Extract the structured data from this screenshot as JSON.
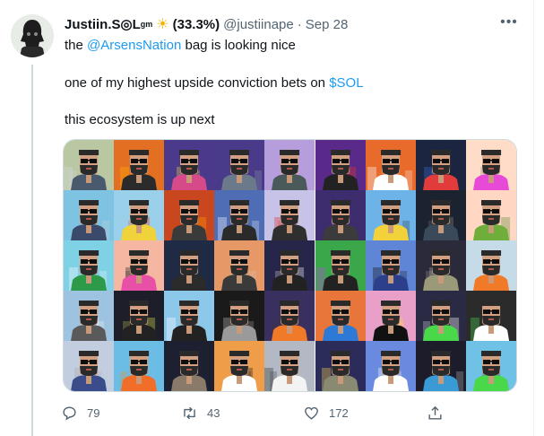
{
  "tweet": {
    "display_name": "Justiin.S◎L",
    "name_superscript": "gm",
    "sun_emoji": "☀",
    "percent": "(33.3%)",
    "handle": "@justiinape",
    "separator": "·",
    "date": "Sep 28",
    "more_label": "•••",
    "line1_prefix": "the ",
    "mention": "@ArsensNation",
    "line1_suffix": " bag is looking nice",
    "line2_prefix": "one of my highest upside conviction bets on ",
    "cashtag": "$SOL",
    "line3": "this ecosystem is up next",
    "actions": {
      "reply_count": "79",
      "retweet_count": "43",
      "like_count": "172"
    }
  },
  "colors": {
    "link": "#1d9bf0",
    "secondary_text": "#536471",
    "primary_text": "#0f1419",
    "sun": "#f5b400"
  },
  "nft_grid": {
    "columns": 9,
    "rows": 5,
    "cells": [
      {
        "bg": "#b9c7a3",
        "shirt": "#4a5a6e",
        "accent": "#d9d9d9"
      },
      {
        "bg": "#e36f22",
        "shirt": "#2b2b2b",
        "accent": "#ffb000"
      },
      {
        "bg": "#4b3a8c",
        "shirt": "#d64a8a",
        "accent": "#f2d04a"
      },
      {
        "bg": "#4a3a8a",
        "shirt": "#6b7a8a",
        "accent": "#9aa"
      },
      {
        "bg": "#b69ddb",
        "shirt": "#4a5a5a",
        "accent": "#ffd1ff"
      },
      {
        "bg": "#5a2a8a",
        "shirt": "#222222",
        "accent": "#e32"
      },
      {
        "bg": "#e96b2c",
        "shirt": "#ffffff",
        "accent": "#ffffff"
      },
      {
        "bg": "#1b2540",
        "shirt": "#e23b3b",
        "accent": "#3a6ad6"
      },
      {
        "bg": "#ffdcc8",
        "shirt": "#e64ad6",
        "accent": "#8a8"
      },
      {
        "bg": "#7fc3e2",
        "shirt": "#3b4a6a",
        "accent": "#d4d4d4"
      },
      {
        "bg": "#9ad0ea",
        "shirt": "#f0d23a",
        "accent": "#e33"
      },
      {
        "bg": "#c9471e",
        "shirt": "#3a3a3a",
        "accent": "#ff9a00"
      },
      {
        "bg": "#4e6db5",
        "shirt": "#2a2a2a",
        "accent": "#ffffff"
      },
      {
        "bg": "#c7c2e8",
        "shirt": "#2f2f2f",
        "accent": "#d33"
      },
      {
        "bg": "#3d2c6e",
        "shirt": "#3b3b3b",
        "accent": "#c14ad6"
      },
      {
        "bg": "#6eb3e8",
        "shirt": "#f2d13a",
        "accent": "#222"
      },
      {
        "bg": "#1b2230",
        "shirt": "#3a4a5a",
        "accent": "#888"
      },
      {
        "bg": "#ffd7c2",
        "shirt": "#6fae3a",
        "accent": "#5a8a3a"
      },
      {
        "bg": "#7fd1e6",
        "shirt": "#2d9a4a",
        "accent": "#ffffff"
      },
      {
        "bg": "#f6b7a2",
        "shirt": "#e84fa6",
        "accent": "#222"
      },
      {
        "bg": "#1f2a44",
        "shirt": "#2b2b2b",
        "accent": "#ccc"
      },
      {
        "bg": "#e69866",
        "shirt": "#3a3a3a",
        "accent": "#ccc"
      },
      {
        "bg": "#26254a",
        "shirt": "#222222",
        "accent": "#fff"
      },
      {
        "bg": "#3aa84a",
        "shirt": "#222222",
        "accent": "#b94bd6"
      },
      {
        "bg": "#5e85d6",
        "shirt": "#2c3f8a",
        "accent": "#111"
      },
      {
        "bg": "#2a2a3a",
        "shirt": "#9a9a7a",
        "accent": "#aaa"
      },
      {
        "bg": "#c5dbe8",
        "shirt": "#f07a28",
        "accent": "#333"
      },
      {
        "bg": "#9ec3e0",
        "shirt": "#5a5a5a",
        "accent": "#fff"
      },
      {
        "bg": "#1e1e2a",
        "shirt": "#222222",
        "accent": "#d6e24a"
      },
      {
        "bg": "#8cc8ea",
        "shirt": "#222222",
        "accent": "#fff"
      },
      {
        "bg": "#1a1a1a",
        "shirt": "#9a9a9a",
        "accent": "#bbb"
      },
      {
        "bg": "#3a3060",
        "shirt": "#f07a28",
        "accent": "#333"
      },
      {
        "bg": "#e8763a",
        "shirt": "#2c7ad6",
        "accent": "#222"
      },
      {
        "bg": "#e9a0c8",
        "shirt": "#111111",
        "accent": "#ffd24a"
      },
      {
        "bg": "#2a2a44",
        "shirt": "#48d84a",
        "accent": "#fff"
      },
      {
        "bg": "#2b2b2b",
        "shirt": "#ffffff",
        "accent": "#48d84a"
      },
      {
        "bg": "#c2cde0",
        "shirt": "#3a4d8a",
        "accent": "#aaa"
      },
      {
        "bg": "#6cbde6",
        "shirt": "#f06e28",
        "accent": "#ff8a00"
      },
      {
        "bg": "#1c2030",
        "shirt": "#8a7a6a",
        "accent": "#bbb"
      },
      {
        "bg": "#f09d4a",
        "shirt": "#ffffff",
        "accent": "#222"
      },
      {
        "bg": "#b3b9c4",
        "shirt": "#f3f3f3",
        "accent": "#333"
      },
      {
        "bg": "#2c2c5a",
        "shirt": "#8a8a72",
        "accent": "#ffd54a"
      },
      {
        "bg": "#6a8ae0",
        "shirt": "#ffffff",
        "accent": "#fff"
      },
      {
        "bg": "#1c1c2a",
        "shirt": "#3a9ad6",
        "accent": "#ddd"
      },
      {
        "bg": "#6fc2e6",
        "shirt": "#48d84a",
        "accent": "#222"
      }
    ]
  }
}
